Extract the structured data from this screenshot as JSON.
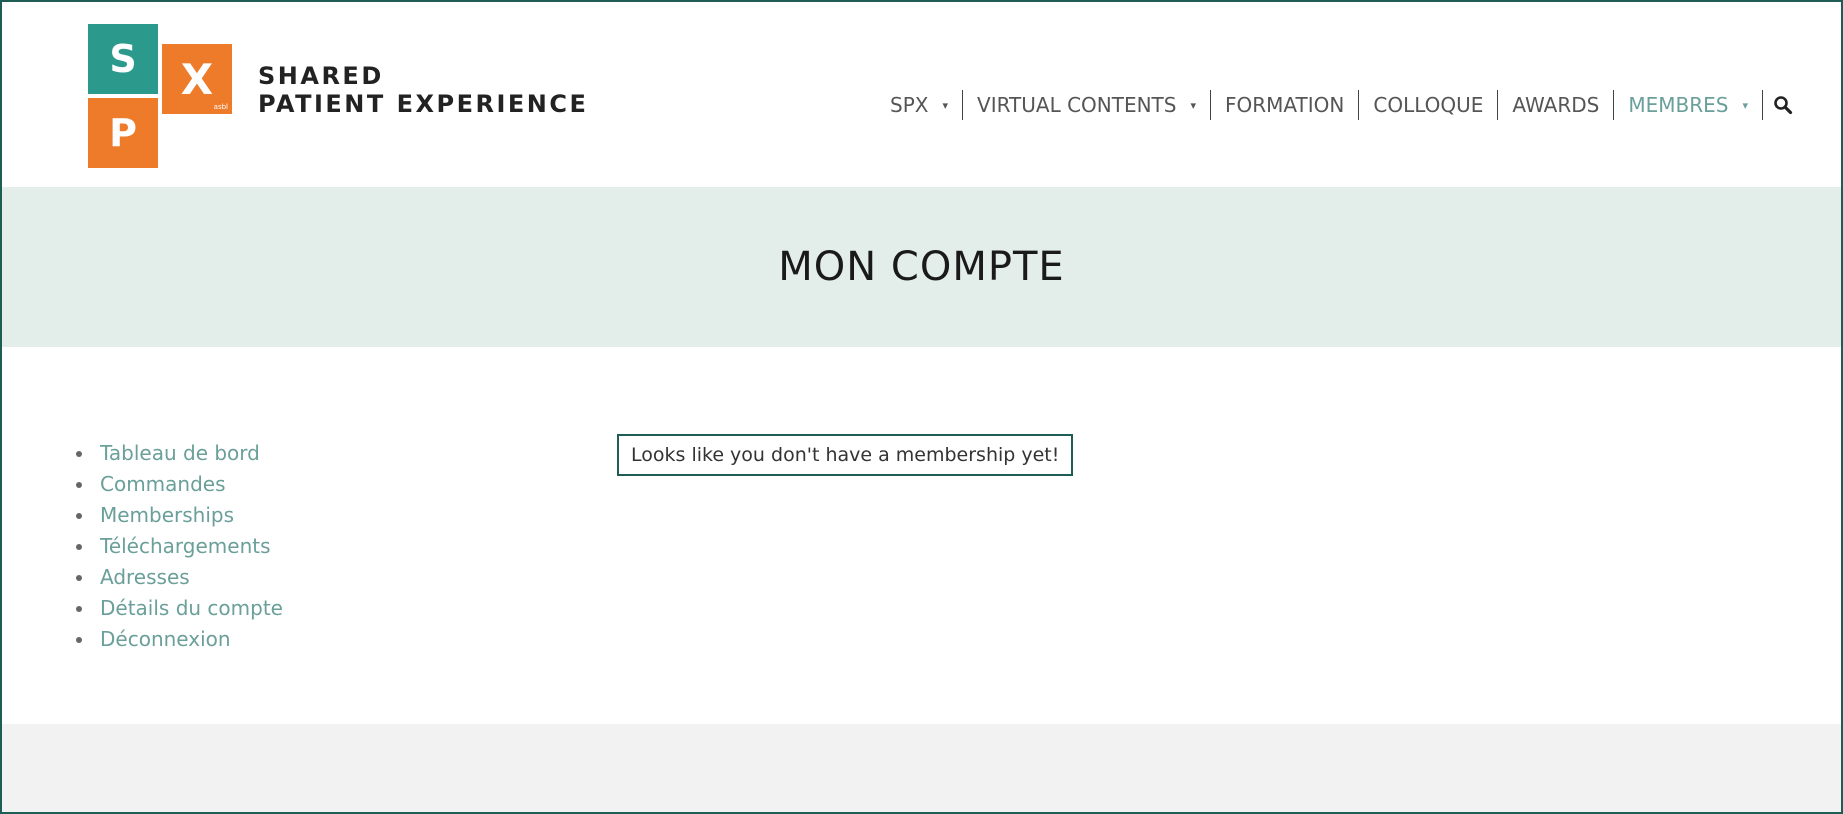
{
  "logo": {
    "letters": [
      "S",
      "X",
      "P"
    ],
    "tagline": "asbl",
    "brand_line1": "SHARED",
    "brand_line2": "PATIENT EXPERIENCE",
    "colors": {
      "teal": "#2b9a8d",
      "orange": "#ee7b2a"
    }
  },
  "nav": {
    "items": [
      {
        "label": "SPX",
        "dropdown": true,
        "active": false
      },
      {
        "label": "VIRTUAL CONTENTS",
        "dropdown": true,
        "active": false
      },
      {
        "label": "FORMATION",
        "dropdown": false,
        "active": false
      },
      {
        "label": "COLLOQUE",
        "dropdown": false,
        "active": false
      },
      {
        "label": "AWARDS",
        "dropdown": false,
        "active": false
      },
      {
        "label": "MEMBRES",
        "dropdown": true,
        "active": true
      }
    ],
    "caret": "▾",
    "search_icon": "search-icon"
  },
  "page": {
    "title": "MON COMPTE"
  },
  "account_nav": {
    "items": [
      "Tableau de bord",
      "Commandes",
      "Memberships",
      "Téléchargements",
      "Adresses",
      "Détails du compte",
      "Déconnexion"
    ]
  },
  "notice": {
    "text": "Looks like you don't have a membership yet!"
  },
  "colors": {
    "accent": "#6a9f9a",
    "band": "#e3eeeb",
    "frame": "#1d5d56",
    "footer": "#f2f2f2"
  }
}
